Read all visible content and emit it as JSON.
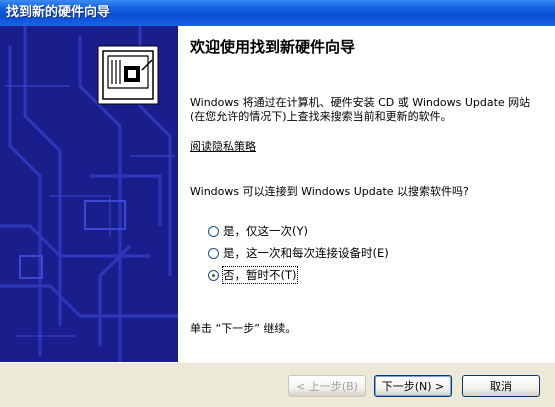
{
  "window": {
    "title": "找到新的硬件向导"
  },
  "main": {
    "heading": "欢迎使用找到新硬件向导",
    "paragraph": "Windows 将通过在计算机、硬件安装 CD 或 Windows Update 网站(在您允许的情况下)上查找来搜索当前和更新的软件。",
    "privacy_link": "阅读隐私策略",
    "question": "Windows 可以连接到 Windows Update 以搜索软件吗?",
    "options": [
      {
        "label": "是，仅这一次(Y)",
        "selected": false
      },
      {
        "label": "是，这一次和每次连接设备时(E)",
        "selected": false
      },
      {
        "label": "否，暂时不(T)",
        "selected": true
      }
    ],
    "instruction": "单击 “下一步” 继续。"
  },
  "buttons": {
    "back": "< 上一步(B)",
    "next": "下一步(N) >",
    "cancel": "取消"
  },
  "colors": {
    "title_bar": "#0A4FD6",
    "left_panel": "#1A1E8C",
    "dialog_bg": "#ECE9D8"
  },
  "icons": {
    "wizard_hardware": "hardware-card-icon"
  }
}
